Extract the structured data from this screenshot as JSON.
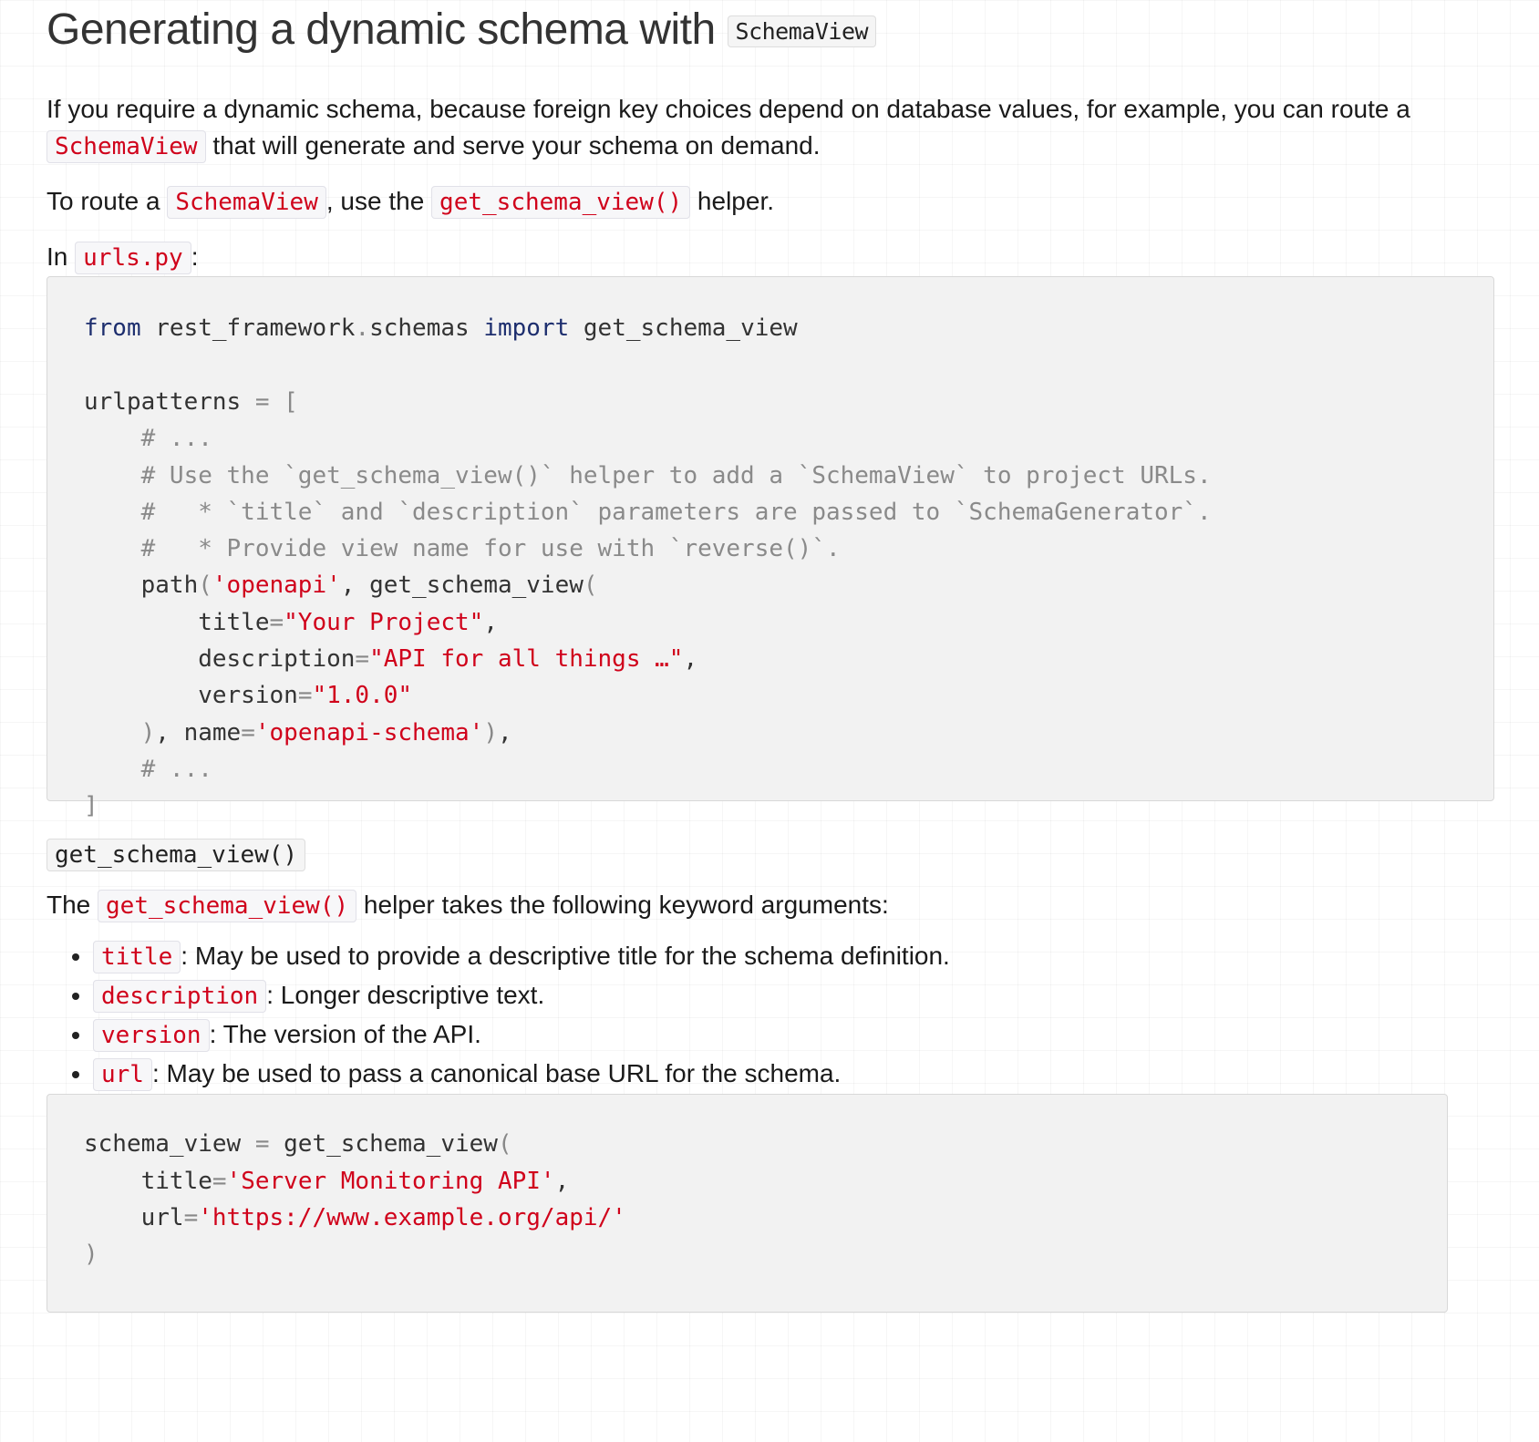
{
  "heading": {
    "text": "Generating a dynamic schema with ",
    "code": "SchemaView"
  },
  "para1": {
    "text_a": "If you require a dynamic schema, because foreign key choices depend on database values, for example, you can route a",
    "code": "SchemaView",
    "text_b": " that will generate and serve your schema on demand."
  },
  "para2": {
    "text_a": "To route a ",
    "code_a": "SchemaView",
    "text_b": ", use the ",
    "code_b": "get_schema_view()",
    "text_c": " helper."
  },
  "para3": {
    "text_a": "In ",
    "code": "urls.py",
    "text_b": ":"
  },
  "code_block_1": {
    "lines": [
      "from rest_framework.schemas import get_schema_view",
      "",
      "urlpatterns = [",
      "    # ...",
      "    # Use the `get_schema_view()` helper to add a `SchemaView` to project URLs.",
      "    #   * `title` and `description` parameters are passed to `SchemaGenerator`.",
      "    #   * Provide view name for use with `reverse()`.",
      "    path('openapi', get_schema_view(",
      "        title=\"Your Project\",",
      "        description=\"API for all things …\",",
      "        version=\"1.0.0\"",
      "    ), name='openapi-schema'),",
      "    # ...",
      "]"
    ]
  },
  "subheading": {
    "code": "get_schema_view()"
  },
  "para4": {
    "text_a": "The ",
    "code": "get_schema_view()",
    "text_b": " helper takes the following keyword arguments:"
  },
  "args": [
    {
      "code": "title",
      "text": ": May be used to provide a descriptive title for the schema definition."
    },
    {
      "code": "description",
      "text": ": Longer descriptive text."
    },
    {
      "code": "version",
      "text": ": The version of the API."
    },
    {
      "code": "url",
      "text": ": May be used to pass a canonical base URL for the schema."
    }
  ],
  "code_block_2": {
    "lines": [
      "schema_view = get_schema_view(",
      "    title='Server Monitoring API',",
      "    url='https://www.example.org/api/'",
      ")"
    ]
  },
  "colors": {
    "inline_code": "#d0021b",
    "keyword": "#1d2e6e",
    "comment": "#8a8a8a",
    "code_bg": "#f2f2f2"
  }
}
